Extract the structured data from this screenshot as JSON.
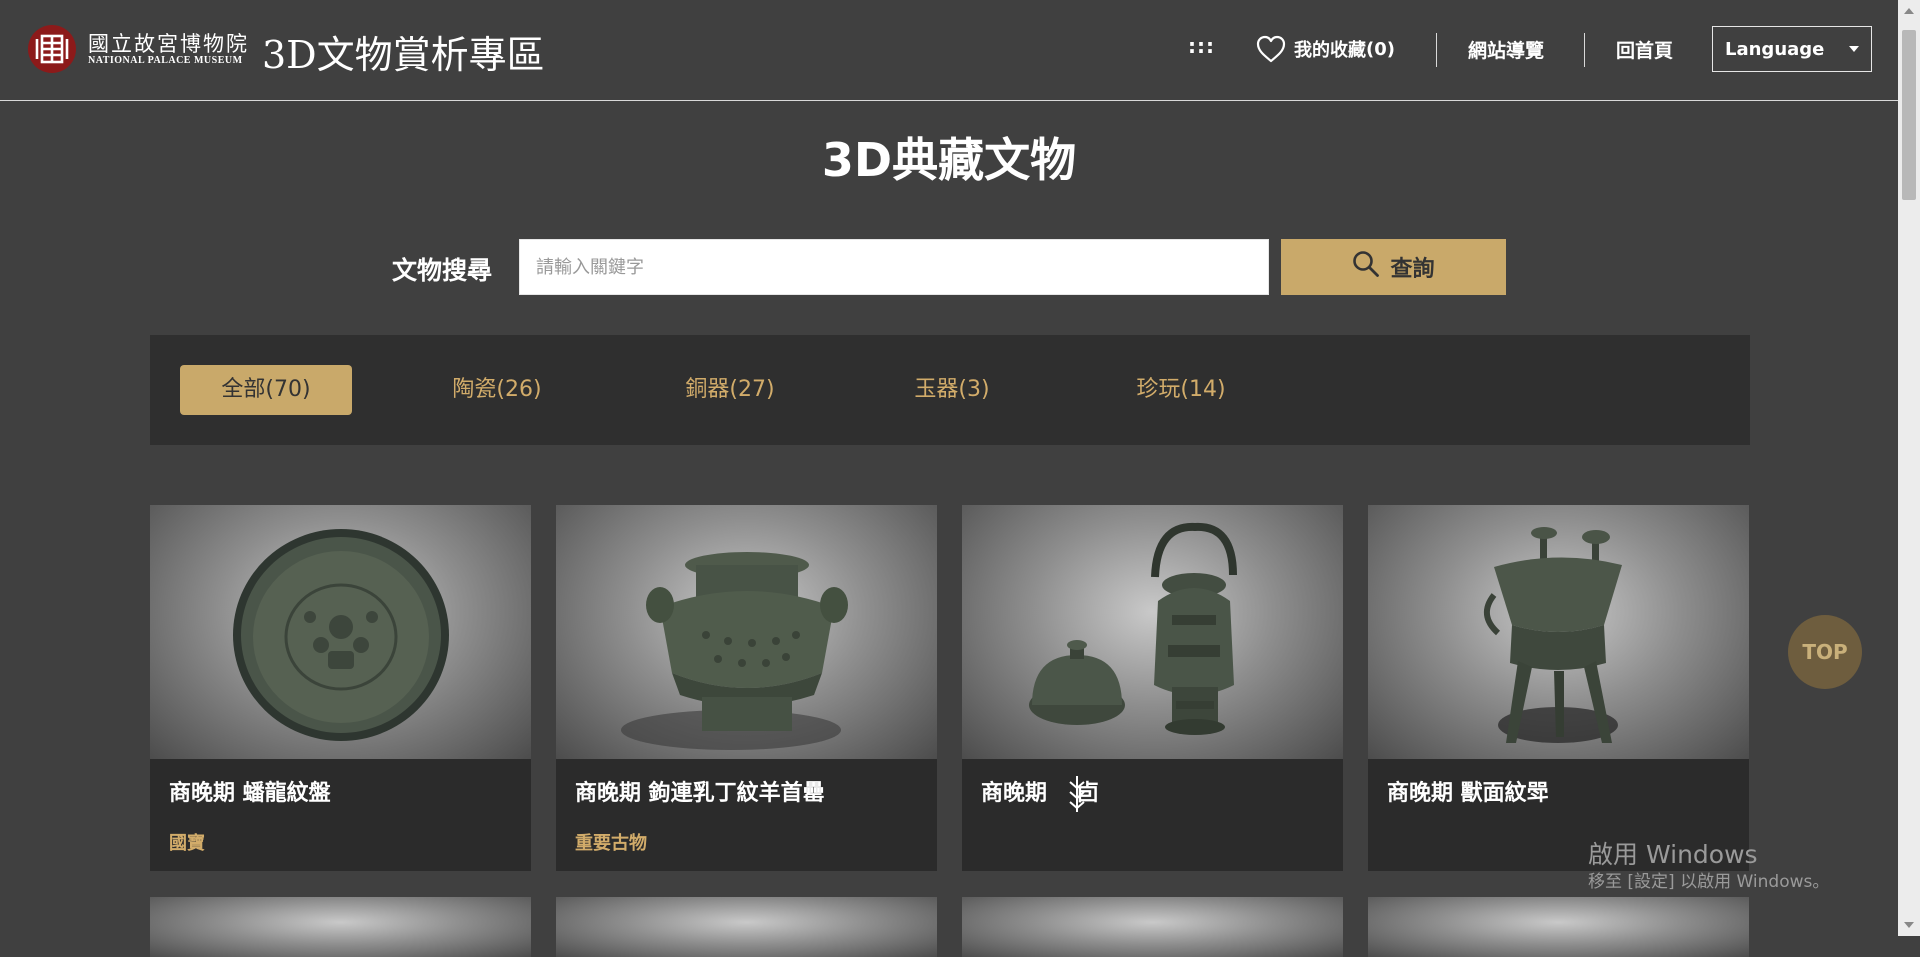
{
  "header": {
    "logo_cn": "國立故宮博物院",
    "logo_en": "NATIONAL PALACE MUSEUM",
    "site_title": "3D文物賞析專區",
    "nav": {
      "menu_icon": ":::",
      "favorites_label": "我的收藏",
      "favorites_count": "(0)",
      "site_guide": "網站導覽",
      "home": "回首頁"
    },
    "language": {
      "selected": "Language"
    }
  },
  "main": {
    "title": "3D典藏文物",
    "search": {
      "label": "文物搜尋",
      "placeholder": "請輸入關鍵字",
      "value": "",
      "button_label": "查詢"
    },
    "filters": [
      {
        "label": "全部(70)",
        "active": true
      },
      {
        "label": "陶瓷(26)",
        "active": false
      },
      {
        "label": "銅器(27)",
        "active": false
      },
      {
        "label": "玉器(3)",
        "active": false
      },
      {
        "label": "珍玩(14)",
        "active": false
      }
    ],
    "cards": [
      {
        "title": "商晚期 蟠龍紋盤",
        "tag": "國寶",
        "icon": "bronze-plate-icon"
      },
      {
        "title": "商晚期 鉤連乳丁紋羊首罍",
        "tag": "重要古物",
        "icon": "bronze-lei-vessel-icon"
      },
      {
        "title": "商晚期 　卣",
        "tag": "",
        "icon": "bronze-you-vessel-icon"
      },
      {
        "title": "商晚期 獸面紋斝",
        "tag": "",
        "icon": "bronze-jia-vessel-icon"
      }
    ]
  },
  "widgets": {
    "top_button": "TOP",
    "activate_title": "啟用 Windows",
    "activate_sub": "移至 [設定] 以啟用 Windows。"
  },
  "colors": {
    "background": "#404040",
    "accent_gold": "#c9a96a",
    "tag_gold": "#d2ac6a",
    "card_bg": "#2b2b2b",
    "filter_bar_bg": "#2f2f2f"
  }
}
